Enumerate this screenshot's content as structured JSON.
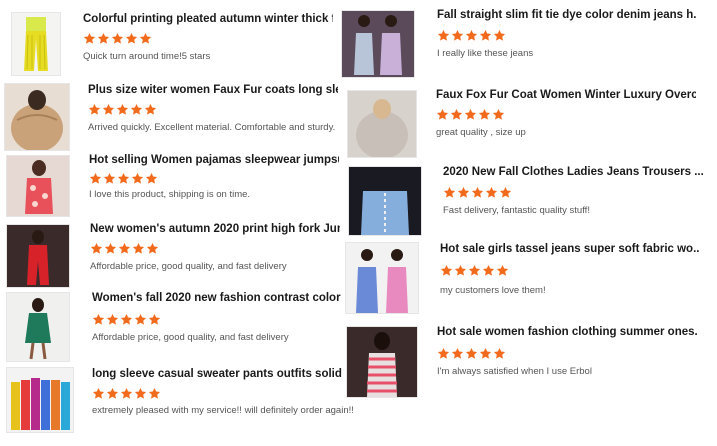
{
  "colors": {
    "star": "#f26a1b",
    "title": "#1a1a1a",
    "comment": "#555555"
  },
  "reviews": [
    {
      "title": "Colorful printing pleated autumn winter thick f...",
      "rating": 5,
      "comment": "Quick turn around time!5 stars",
      "image": "yellow-pleated-pants-photo"
    },
    {
      "title": "Plus size witer women Faux Fur coats long sle...",
      "rating": 5,
      "comment": "Arrived quickly. Excellent material. Comfortable and sturdy.",
      "image": "faux-fur-coat-photo"
    },
    {
      "title": "Hot selling Women pajamas sleepwear jumpsu...",
      "rating": 5,
      "comment": "I love this product, shipping is on time.",
      "image": "floral-jumpsuit-photo"
    },
    {
      "title": "New women's autumn 2020 print high fork Jum...",
      "rating": 5,
      "comment": "Affordable price, good quality, and fast delivery",
      "image": "red-jumpsuit-photo"
    },
    {
      "title": "Women's fall 2020 new fashion contrast color ...",
      "rating": 5,
      "comment": "Affordable price, good quality, and fast delivery",
      "image": "green-dress-photo"
    },
    {
      "title": "long sleeve casual sweater pants outfits solid ...",
      "rating": 5,
      "comment": "extremely pleased with my service!! will definitely order again!!",
      "image": "colorful-outfits-group-photo"
    },
    {
      "title": "Fall straight slim fit tie dye color denim jeans h...",
      "rating": 5,
      "comment": "I really like these jeans",
      "image": "tie-dye-jeans-photo"
    },
    {
      "title": "Faux Fox Fur Coat Women Winter Luxury Overc...",
      "rating": 5,
      "comment": "great quality , size up",
      "image": "fox-fur-coat-photo"
    },
    {
      "title": "2020 New Fall Clothes Ladies Jeans Trousers ...",
      "rating": 5,
      "comment": "Fast delivery, fantastic quality stuff!",
      "image": "lace-up-jeans-photo"
    },
    {
      "title": "Hot sale girls tassel jeans super soft fabric wo...",
      "rating": 5,
      "comment": "my customers love them!",
      "image": "tassel-jeans-photo"
    },
    {
      "title": "Hot sale women fashion clothing summer ones...",
      "rating": 5,
      "comment": "I'm always satisfied when I use Erbol",
      "image": "striped-onesie-photo"
    }
  ]
}
